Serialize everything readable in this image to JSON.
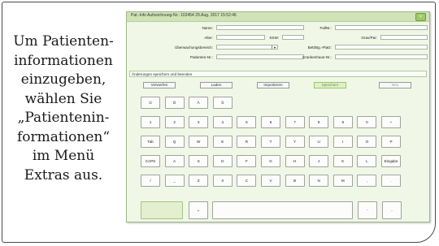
{
  "caption": [
    "Um Patienten-",
    "informationen",
    "einzugeben,",
    "wählen Sie",
    "„Patientenin-",
    "formationen“",
    "im Menü",
    "Extras aus."
  ],
  "window": {
    "title": "Pat.-Info Aufzeichnung-Nr.: 102454   29.Aug. 2017 15:52:46",
    "close_label": "×"
  },
  "form": {
    "name_label": "Name:",
    "fall_label": "FallNr.:",
    "alter_label": "Alter:",
    "ssw_label": "SSW:",
    "grav_label": "Grav/Par:",
    "uebw_label": "Überwachungsbereich:",
    "bett_label": "Bett/Bg.-Platz:",
    "patnr_label": "Patienten-Nr.:",
    "khnr_label": "Krankenhaus-Nr.:",
    "uebw_arrow": "▾"
  },
  "hint": "Änderungen speichern und beenden",
  "actions": [
    "Verwerfen",
    "Laden",
    "Importieren",
    "Speichern",
    "Neu"
  ],
  "keyboard": {
    "row1": [
      "Ü",
      "Ö",
      "Ä",
      "ß"
    ],
    "row2": [
      "1",
      "2",
      "3",
      "4",
      "5",
      "6",
      "7",
      "8",
      "9",
      "0",
      "+"
    ],
    "row3": [
      "Tab",
      "Q",
      "W",
      "E",
      "R",
      "T",
      "Y",
      "U",
      "I",
      "O",
      "P"
    ],
    "row4": [
      "CAPS",
      "A",
      "S",
      "D",
      "F",
      "G",
      "H",
      "J",
      "K",
      "L",
      "Eingabe"
    ],
    "row5": [
      "/",
      "_",
      "Z",
      "X",
      "C",
      "V",
      "B",
      "N",
      "M",
      ",",
      "."
    ],
    "row6": [
      "",
      "+",
      "",
      "'",
      "-"
    ]
  }
}
